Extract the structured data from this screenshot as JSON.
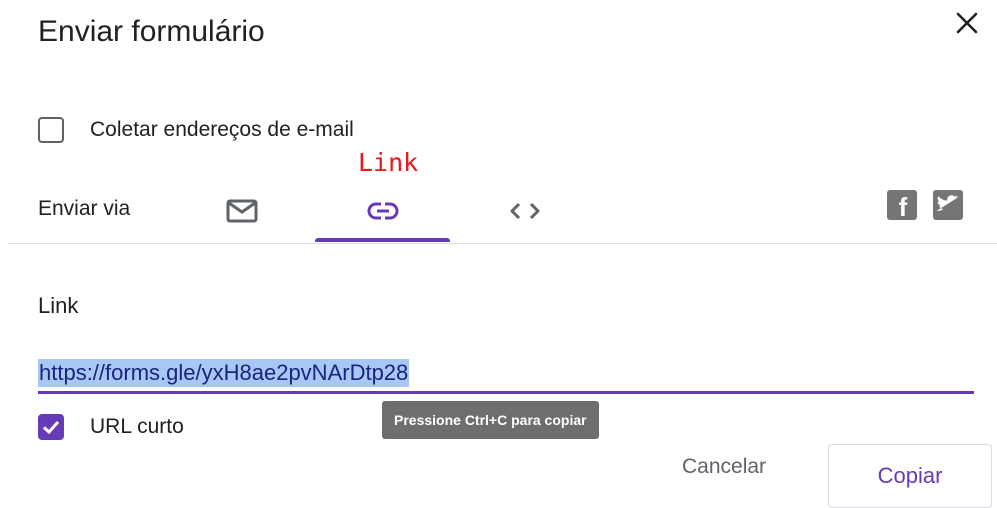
{
  "dialog": {
    "title": "Enviar formulário"
  },
  "collect_email": {
    "label": "Coletar endereços de e-mail",
    "checked": false
  },
  "annotation": "Link",
  "send_via": {
    "label": "Enviar via",
    "tabs": [
      {
        "name": "email",
        "icon": "mail-icon",
        "selected": false
      },
      {
        "name": "link",
        "icon": "link-icon",
        "selected": true
      },
      {
        "name": "embed",
        "icon": "code-icon",
        "selected": false
      }
    ],
    "social": [
      {
        "icon": "facebook-icon",
        "glyph": "f"
      },
      {
        "icon": "twitter-icon"
      }
    ]
  },
  "link_section": {
    "heading": "Link",
    "url": "https://forms.gle/yxH8ae2pvNArDtp28",
    "short_url_label": "URL curto",
    "short_url_checked": true,
    "tooltip": "Pressione Ctrl+C para copiar"
  },
  "actions": {
    "cancel": "Cancelar",
    "copy": "Copiar"
  },
  "colors": {
    "accent": "#673ab7",
    "annotation": "#e8171b",
    "selection": "#a7c8f5",
    "icon_gray": "#757575"
  }
}
